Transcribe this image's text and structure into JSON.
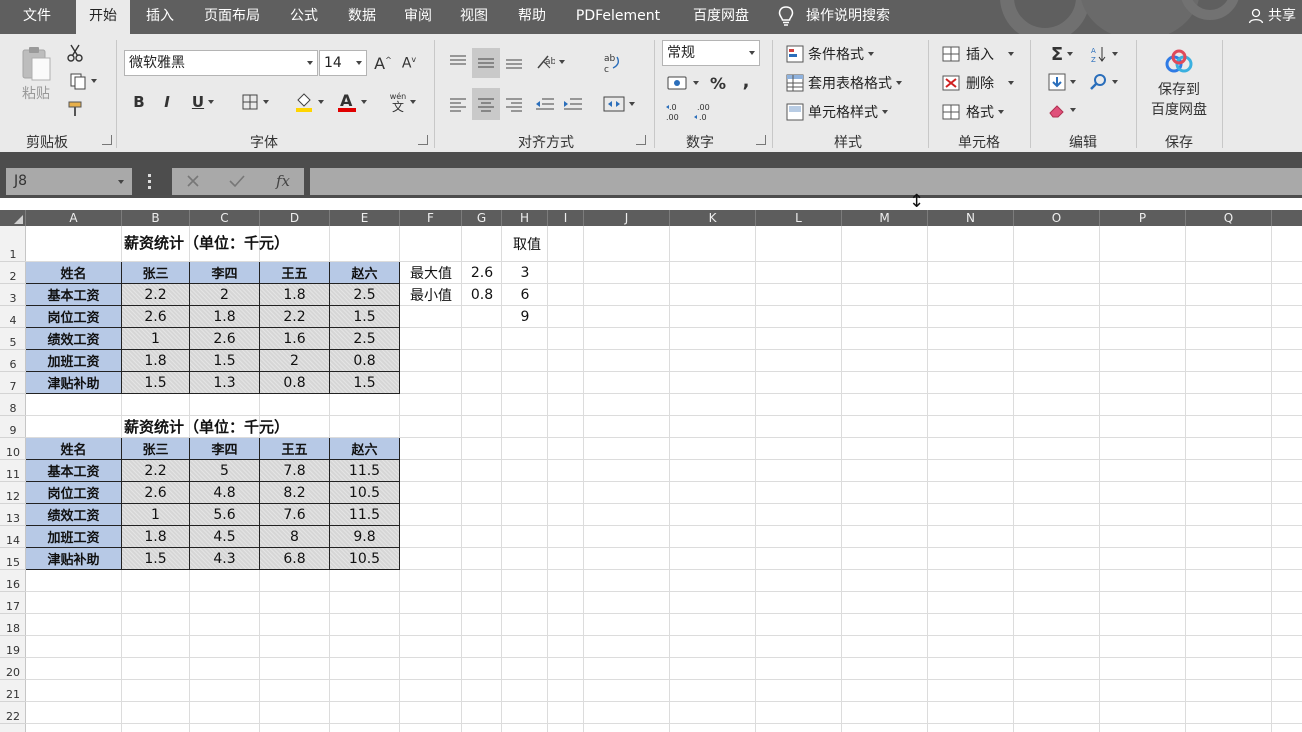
{
  "menubar": {
    "tabs": [
      "文件",
      "开始",
      "插入",
      "页面布局",
      "公式",
      "数据",
      "审阅",
      "视图",
      "帮助",
      "PDFelement",
      "百度网盘"
    ],
    "active_tab": "开始",
    "tell_me": "操作说明搜索",
    "share": "共享"
  },
  "ribbon": {
    "clipboard": {
      "paste": "粘贴",
      "group": "剪贴板"
    },
    "font": {
      "name": "微软雅黑",
      "size": "14",
      "bold": "B",
      "italic": "I",
      "underline": "U",
      "group": "字体",
      "pinyin": "wén"
    },
    "alignment": {
      "group": "对齐方式"
    },
    "number": {
      "format": "常规",
      "percent": "%",
      "comma": ",",
      "group": "数字"
    },
    "styles": {
      "conditional": "条件格式",
      "table": "套用表格格式",
      "cell": "单元格样式",
      "group": "样式"
    },
    "cells": {
      "insert": "插入",
      "delete": "删除",
      "format": "格式",
      "group": "单元格"
    },
    "editing": {
      "sigma": "Σ",
      "group": "编辑"
    },
    "save": {
      "line1": "保存到",
      "line2": "百度网盘",
      "group": "保存"
    }
  },
  "formula_bar": {
    "name_box": "J8",
    "fx": "fx",
    "value": ""
  },
  "columns": [
    "A",
    "B",
    "C",
    "D",
    "E",
    "F",
    "G",
    "H",
    "I",
    "J",
    "K",
    "L",
    "M",
    "N",
    "O",
    "P",
    "Q"
  ],
  "rows": [
    "1",
    "2",
    "3",
    "4",
    "5",
    "6",
    "7",
    "8",
    "9",
    "10",
    "11",
    "12",
    "13",
    "14",
    "15",
    "16",
    "17",
    "18",
    "19",
    "20",
    "21",
    "22"
  ],
  "table1": {
    "title": "薪资统计（单位：千元）",
    "header": [
      "姓名",
      "张三",
      "李四",
      "王五",
      "赵六"
    ],
    "rows": [
      [
        "基本工资",
        "2.2",
        "2",
        "1.8",
        "2.5"
      ],
      [
        "岗位工资",
        "2.6",
        "1.8",
        "2.2",
        "1.5"
      ],
      [
        "绩效工资",
        "1",
        "2.6",
        "1.6",
        "2.5"
      ],
      [
        "加班工资",
        "1.8",
        "1.5",
        "2",
        "0.8"
      ],
      [
        "津贴补助",
        "1.5",
        "1.3",
        "0.8",
        "1.5"
      ]
    ]
  },
  "table2": {
    "title": "薪资统计（单位：千元）",
    "header": [
      "姓名",
      "张三",
      "李四",
      "王五",
      "赵六"
    ],
    "rows": [
      [
        "基本工资",
        "2.2",
        "5",
        "7.8",
        "11.5"
      ],
      [
        "岗位工资",
        "2.6",
        "4.8",
        "8.2",
        "10.5"
      ],
      [
        "绩效工资",
        "1",
        "5.6",
        "7.6",
        "11.5"
      ],
      [
        "加班工资",
        "1.8",
        "4.5",
        "8",
        "9.8"
      ],
      [
        "津贴补助",
        "1.5",
        "4.3",
        "6.8",
        "10.5"
      ]
    ]
  },
  "side": {
    "take_value_label": "取值",
    "max_label": "最大值",
    "max_value": "2.6",
    "min_label": "最小值",
    "min_value": "0.8",
    "take_values": [
      "3",
      "6",
      "9"
    ]
  }
}
